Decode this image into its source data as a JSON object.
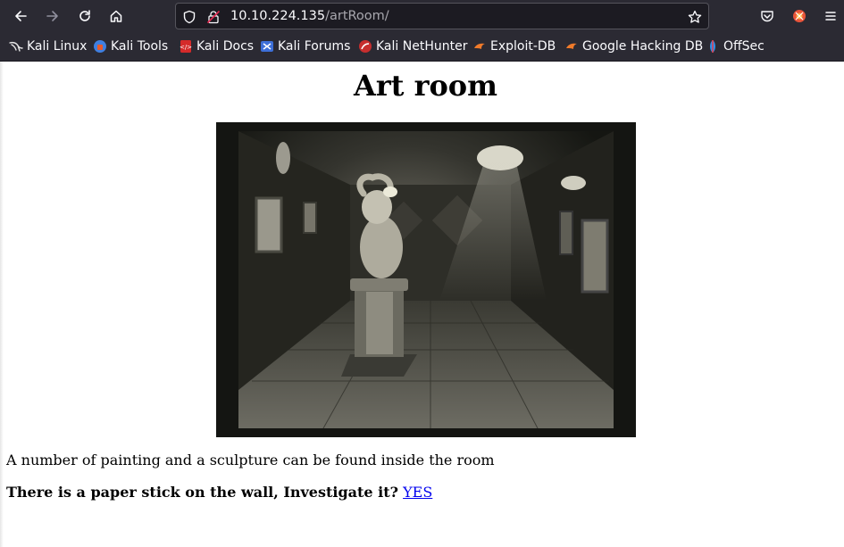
{
  "browser": {
    "url_host": "10.10.224.135",
    "url_path": "/artRoom/",
    "bookmarks": [
      {
        "label": "Kali Linux",
        "icon": "kali-dragon-icon"
      },
      {
        "label": "Kali Tools",
        "icon": "kali-tools-icon"
      },
      {
        "label": "Kali Docs",
        "icon": "kali-docs-icon"
      },
      {
        "label": "Kali Forums",
        "icon": "kali-forums-icon"
      },
      {
        "label": "Kali NetHunter",
        "icon": "kali-nethunter-icon"
      },
      {
        "label": "Exploit-DB",
        "icon": "exploit-db-icon"
      },
      {
        "label": "Google Hacking DB",
        "icon": "google-hacking-db-icon"
      },
      {
        "label": "OffSec",
        "icon": "offsec-icon"
      }
    ]
  },
  "page": {
    "title": "Art room",
    "description": "A number of painting and a sculpture can be found inside the room",
    "question": "There is a paper stick on the wall, Investigate it?",
    "yes_link": "YES"
  },
  "colors": {
    "chrome_bg": "#2b2a33",
    "urlbar_bg": "#1c1b22",
    "link": "#0000ee"
  }
}
